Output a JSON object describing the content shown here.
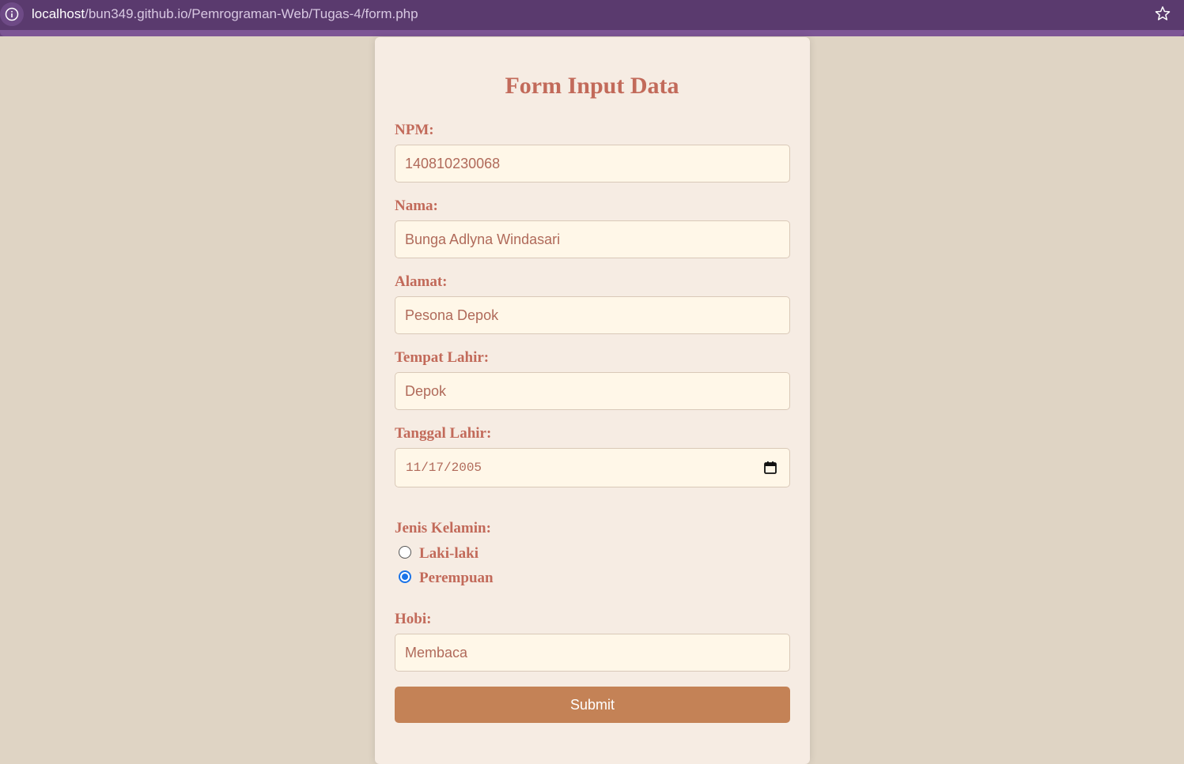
{
  "browser": {
    "url_host": "localhost",
    "url_path": "/bun349.github.io/Pemrograman-Web/Tugas-4/form.php"
  },
  "form": {
    "title": "Form Input Data",
    "npm_label": "NPM:",
    "npm_value": "140810230068",
    "nama_label": "Nama:",
    "nama_value": "Bunga Adlyna Windasari",
    "alamat_label": "Alamat:",
    "alamat_value": "Pesona Depok",
    "tempat_lahir_label": "Tempat Lahir:",
    "tempat_lahir_value": "Depok",
    "tanggal_lahir_label": "Tanggal Lahir:",
    "tanggal_lahir_value": "11/17/2005",
    "jenis_kelamin_label": "Jenis Kelamin:",
    "gender_options": [
      "Laki-laki",
      "Perempuan"
    ],
    "gender_selected": "Perempuan",
    "hobi_label": "Hobi:",
    "hobi_value": "Membaca",
    "submit_label": "Submit"
  },
  "icons": {
    "info": "info-icon",
    "star": "star-icon",
    "calendar": "calendar-icon"
  },
  "colors": {
    "page_bg": "#dfd4c4",
    "card_bg": "#f6ece3",
    "accent_text": "#c26a5a",
    "button": "#c48256",
    "browser_bar": "#5a3a6e"
  }
}
